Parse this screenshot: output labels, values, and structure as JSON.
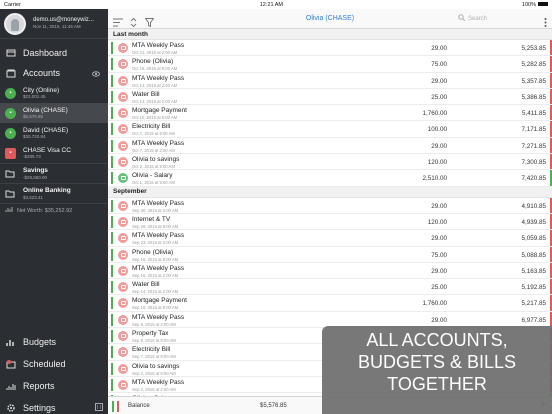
{
  "status_bar": {
    "carrier": "Carrier",
    "time": "12:21 AM",
    "battery": "100%"
  },
  "profile": {
    "email": "demo.us@moneywiz...",
    "datetime": "Nov 11, 2015, 11:46 AM"
  },
  "nav": {
    "dashboard": "Dashboard",
    "accounts": "Accounts",
    "budgets": "Budgets",
    "scheduled": "Scheduled",
    "reports": "Reports",
    "settings": "Settings"
  },
  "accounts": [
    {
      "name": "City (Online)",
      "balance": "$23,001.45",
      "color": "#4caf50"
    },
    {
      "name": "Olivia (CHASE)",
      "balance": "$5,576.85",
      "color": "#4caf50"
    },
    {
      "name": "David (CHASE)",
      "balance": "$30,720.84",
      "color": "#4caf50"
    },
    {
      "name": "CHASE Visa CC",
      "balance": "-$289.73",
      "color": "#e05a5a"
    }
  ],
  "groups": [
    {
      "name": "Savings",
      "balance": "-$29,650.00"
    },
    {
      "name": "Online Banking",
      "balance": "$3,523.41"
    }
  ],
  "net_worth": "Net Worth: $35,252.92",
  "main": {
    "title": "Olivia (CHASE)",
    "search_placeholder": "Search",
    "balance_label": "Balance",
    "balance_value": "$5,576.85"
  },
  "sections": [
    {
      "title": "Last month",
      "rows": [
        {
          "name": "MTA Weekly Pass",
          "date": "Oct 21, 2015 at 2:00 AM",
          "amount": "29.00",
          "balance": "5,253.85",
          "type": "expense"
        },
        {
          "name": "Phone (Olivia)",
          "date": "Oct 16, 2015 at 9:00 AM",
          "amount": "75.00",
          "balance": "5,282.85",
          "type": "expense"
        },
        {
          "name": "MTA Weekly Pass",
          "date": "Oct 14, 2015 at 2:00 AM",
          "amount": "29.00",
          "balance": "5,357.85",
          "type": "expense"
        },
        {
          "name": "Water Bill",
          "date": "Oct 14, 2015 at 2:00 AM",
          "amount": "25.00",
          "balance": "5,386.85",
          "type": "expense"
        },
        {
          "name": "Mortgage Payment",
          "date": "Oct 10, 2015 at 9:00 AM",
          "amount": "1,760.00",
          "balance": "5,411.85",
          "type": "expense"
        },
        {
          "name": "Electricity Bill",
          "date": "Oct 7, 2015 at 9:00 AM",
          "amount": "100.00",
          "balance": "7,171.85",
          "type": "expense"
        },
        {
          "name": "MTA Weekly Pass",
          "date": "Oct 7, 2015 at 2:00 AM",
          "amount": "29.00",
          "balance": "7,271.85",
          "type": "expense"
        },
        {
          "name": "Olivia to savings",
          "date": "Oct 2, 2015 at 9:00 AM",
          "amount": "120.00",
          "balance": "7,300.85",
          "type": "expense"
        },
        {
          "name": "Olivia - Salary",
          "date": "Oct 1, 2015 at 9:00 AM",
          "amount": "2,510.00",
          "balance": "7,420.85",
          "type": "income"
        }
      ]
    },
    {
      "title": "September",
      "rows": [
        {
          "name": "MTA Weekly Pass",
          "date": "Sep 30, 2015 at 2:00 AM",
          "amount": "29.00",
          "balance": "4,910.85",
          "type": "expense"
        },
        {
          "name": "Internet & TV",
          "date": "Sep 26, 2015 at 9:00 AM",
          "amount": "120.00",
          "balance": "4,939.85",
          "type": "expense"
        },
        {
          "name": "MTA Weekly Pass",
          "date": "Sep 23, 2015 at 2:00 AM",
          "amount": "29.00",
          "balance": "5,059.85",
          "type": "expense"
        },
        {
          "name": "Phone (Olivia)",
          "date": "Sep 16, 2015 at 9:00 AM",
          "amount": "75.00",
          "balance": "5,088.85",
          "type": "expense"
        },
        {
          "name": "MTA Weekly Pass",
          "date": "Sep 16, 2015 at 2:00 AM",
          "amount": "29.00",
          "balance": "5,163.85",
          "type": "expense"
        },
        {
          "name": "Water Bill",
          "date": "Sep 14, 2015 at 2:00 AM",
          "amount": "25.00",
          "balance": "5,192.85",
          "type": "expense"
        },
        {
          "name": "Mortgage Payment",
          "date": "Sep 10, 2015 at 9:00 AM",
          "amount": "1,760.00",
          "balance": "5,217.85",
          "type": "expense"
        },
        {
          "name": "MTA Weekly Pass",
          "date": "Sep 9, 2015 at 2:00 AM",
          "amount": "29.00",
          "balance": "6,977.85",
          "type": "expense"
        },
        {
          "name": "Property Tax",
          "date": "Sep 8, 2015 at 9:00 AM",
          "amount": "",
          "balance": "",
          "type": "expense"
        },
        {
          "name": "Electricity Bill",
          "date": "Sep 7, 2015 at 9:00 AM",
          "amount": "",
          "balance": "",
          "type": "expense"
        },
        {
          "name": "Olivia to savings",
          "date": "Sep 2, 2015 at 9:00 AM",
          "amount": "",
          "balance": "",
          "type": "expense"
        },
        {
          "name": "MTA Weekly Pass",
          "date": "Sep 2, 2015 at 2:00 AM",
          "amount": "",
          "balance": "",
          "type": "expense"
        },
        {
          "name": "Olivia - Salary",
          "date": "",
          "amount": "",
          "balance": "",
          "type": "income"
        }
      ]
    }
  ],
  "overlay": {
    "line1": "ALL ACCOUNTS,",
    "line2": "BUDGETS & BILLS",
    "line3": "TOGETHER"
  }
}
